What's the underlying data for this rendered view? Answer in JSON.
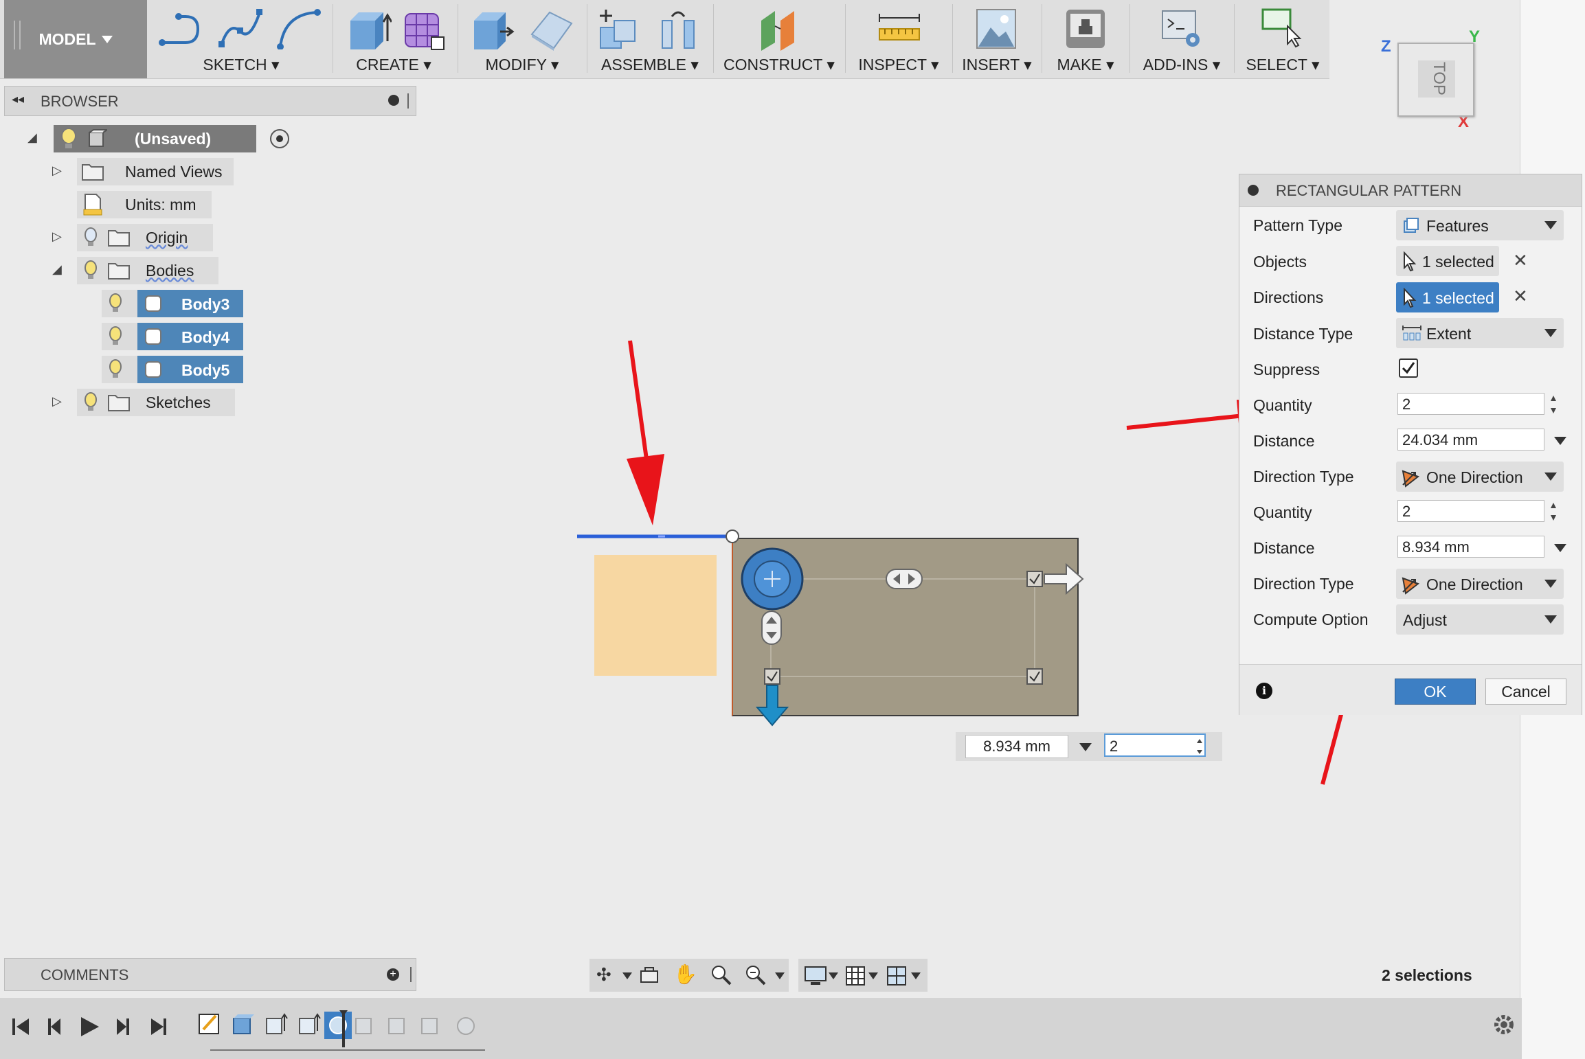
{
  "toolbar": {
    "model_label": "MODEL",
    "groups": [
      {
        "label": "SKETCH"
      },
      {
        "label": "CREATE"
      },
      {
        "label": "MODIFY"
      },
      {
        "label": "ASSEMBLE"
      },
      {
        "label": "CONSTRUCT"
      },
      {
        "label": "INSPECT"
      },
      {
        "label": "INSERT"
      },
      {
        "label": "MAKE"
      },
      {
        "label": "ADD-INS"
      },
      {
        "label": "SELECT"
      }
    ]
  },
  "viewcube": {
    "face": "TOP",
    "axis_z": "Z",
    "axis_y": "Y",
    "axis_x": "X"
  },
  "browser": {
    "title": "BROWSER",
    "items": [
      {
        "label": "(Unsaved)"
      },
      {
        "label": "Named Views"
      },
      {
        "label": "Units: mm"
      },
      {
        "label": "Origin"
      },
      {
        "label": "Bodies"
      },
      {
        "label": "Body3"
      },
      {
        "label": "Body4"
      },
      {
        "label": "Body5"
      },
      {
        "label": "Sketches"
      }
    ]
  },
  "dialog": {
    "title": "RECTANGULAR PATTERN",
    "rows": [
      {
        "label": "Pattern Type",
        "value": "Features"
      },
      {
        "label": "Objects",
        "value": "1 selected"
      },
      {
        "label": "Directions",
        "value": "1 selected"
      },
      {
        "label": "Distance Type",
        "value": "Extent"
      },
      {
        "label": "Suppress"
      },
      {
        "label": "Quantity",
        "value": "2"
      },
      {
        "label": "Distance",
        "value": "24.034 mm"
      },
      {
        "label": "Direction Type",
        "value": "One Direction"
      },
      {
        "label": "Quantity",
        "value": "2"
      },
      {
        "label": "Distance",
        "value": "8.934 mm"
      },
      {
        "label": "Direction Type",
        "value": "One Direction"
      },
      {
        "label": "Compute Option",
        "value": "Adjust"
      }
    ],
    "ok_label": "OK",
    "cancel_label": "Cancel"
  },
  "canvas_inputs": {
    "distance": "8.934 mm",
    "quantity": "2"
  },
  "comments": {
    "title": "COMMENTS"
  },
  "status": {
    "selections": "2 selections"
  },
  "colors": {
    "accent_blue": "#3d7fc4",
    "annotation_red": "#e8141a",
    "selected_body": "#a29a86",
    "other_body": "#f7d7a2"
  }
}
